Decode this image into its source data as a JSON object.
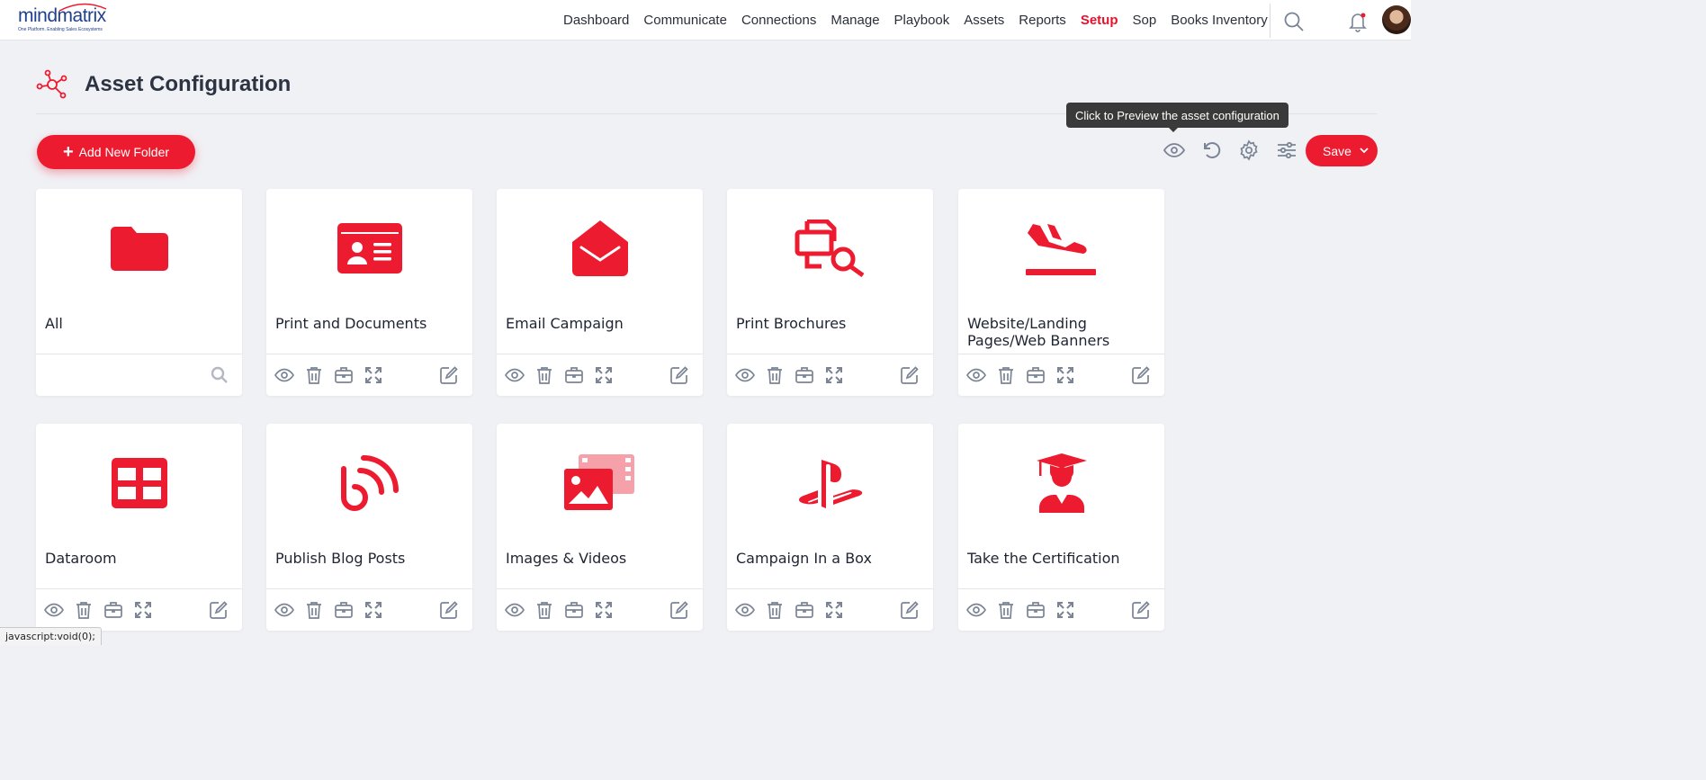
{
  "brand": {
    "logo_text": "mindmatrix",
    "tagline": "One Platform. Enabling Sales Ecosystems",
    "accent": "#ed1b2f",
    "secondary": "#1f3f8f"
  },
  "nav": {
    "items": [
      {
        "label": "Dashboard",
        "active": false
      },
      {
        "label": "Communicate",
        "active": false
      },
      {
        "label": "Connections",
        "active": false
      },
      {
        "label": "Manage",
        "active": false
      },
      {
        "label": "Playbook",
        "active": false
      },
      {
        "label": "Assets",
        "active": false
      },
      {
        "label": "Reports",
        "active": false
      },
      {
        "label": "Setup",
        "active": true
      },
      {
        "label": "Sop",
        "active": false
      },
      {
        "label": "Books Inventory",
        "active": false
      }
    ],
    "icons": [
      "search-icon",
      "bell-icon",
      "avatar"
    ]
  },
  "page": {
    "title": "Asset Configuration",
    "title_icon": "network-icon"
  },
  "toolbar": {
    "add_folder_label": "Add New Folder",
    "tooltip": "Click to Preview the asset configuration",
    "icons": [
      "eye-icon",
      "undo-icon",
      "gear-icon",
      "sliders-icon"
    ],
    "save_label": "Save"
  },
  "cards": [
    {
      "title": "All",
      "icon": "folder-icon",
      "footer": "search"
    },
    {
      "title": "Print and Documents",
      "icon": "id-card-icon",
      "footer": "actions"
    },
    {
      "title": "Email Campaign",
      "icon": "envelope-open-icon",
      "footer": "actions"
    },
    {
      "title": "Print Brochures",
      "icon": "file-search-icon",
      "footer": "actions"
    },
    {
      "title": "Website/Landing Pages/Web Banners",
      "icon": "plane-landing-icon",
      "footer": "actions"
    },
    {
      "title": "Dataroom",
      "icon": "grid-table-icon",
      "footer": "actions"
    },
    {
      "title": "Publish Blog Posts",
      "icon": "blog-feed-icon",
      "footer": "actions"
    },
    {
      "title": "Images & Videos",
      "icon": "photo-film-icon",
      "footer": "actions"
    },
    {
      "title": "Campaign In a Box",
      "icon": "playstation-icon",
      "footer": "actions"
    },
    {
      "title": "Take the Certification",
      "icon": "graduate-icon",
      "footer": "actions"
    }
  ],
  "card_actions": [
    "eye-icon",
    "trash-icon",
    "briefcase-icon",
    "expand-icon",
    "edit-icon"
  ],
  "status_bar": "javascript:void(0);"
}
